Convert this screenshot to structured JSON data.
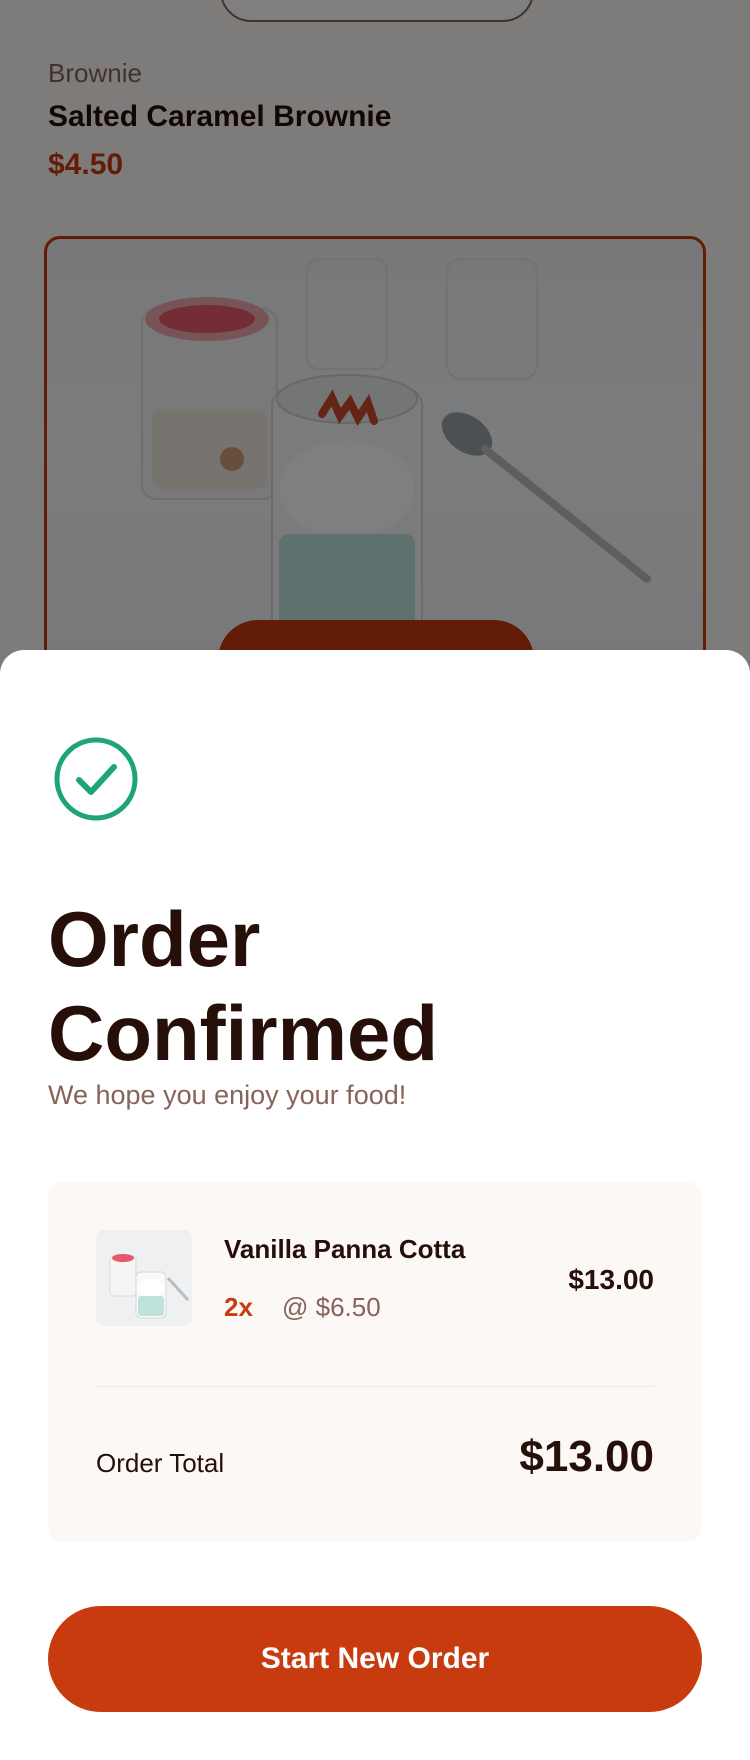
{
  "background": {
    "product": {
      "category": "Brownie",
      "name": "Salted Caramel Brownie",
      "price": "$4.50"
    }
  },
  "modal": {
    "icon": "check-circle-icon",
    "title": "Order Confirmed",
    "subtitle": "We hope you enjoy your food!",
    "items": [
      {
        "name": "Vanilla Panna Cotta",
        "quantity": "2x",
        "unit_price": "@ $6.50",
        "line_total": "$13.00",
        "thumbnail": "panna-cotta-thumbnail"
      }
    ],
    "order_total_label": "Order Total",
    "order_total_value": "$13.00",
    "start_new_order_label": "Start New Order"
  },
  "colors": {
    "accent": "#c73b0f",
    "success": "#1ea575",
    "text_dark": "#260f08",
    "text_muted": "#87635a",
    "summary_bg": "#fcf8f6"
  }
}
